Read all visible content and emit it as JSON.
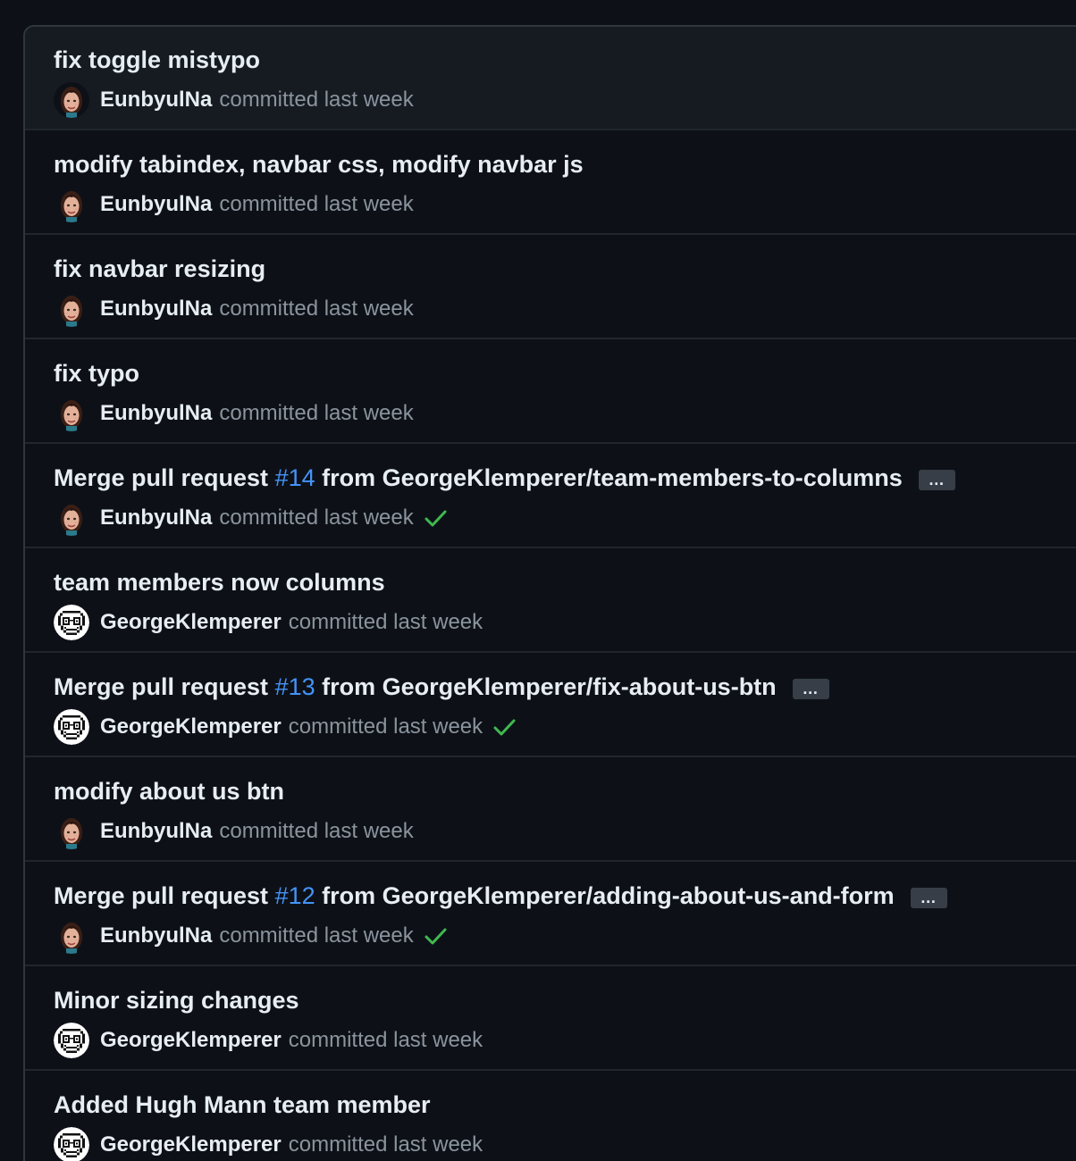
{
  "commits": [
    {
      "title": "fix toggle mistypo",
      "title_suffix": "",
      "pr": "",
      "author": "EunbyulNa",
      "when": "committed last week",
      "has_more": false,
      "has_check": false,
      "avatar": "memoji-avatar"
    },
    {
      "title": "modify tabindex, navbar css, modify navbar js",
      "title_suffix": "",
      "pr": "",
      "author": "EunbyulNa",
      "when": "committed last week",
      "has_more": false,
      "has_check": false,
      "avatar": "memoji-avatar"
    },
    {
      "title": "fix navbar resizing",
      "title_suffix": "",
      "pr": "",
      "author": "EunbyulNa",
      "when": "committed last week",
      "has_more": false,
      "has_check": false,
      "avatar": "memoji-avatar"
    },
    {
      "title": "fix typo",
      "title_suffix": "",
      "pr": "",
      "author": "EunbyulNa",
      "when": "committed last week",
      "has_more": false,
      "has_check": false,
      "avatar": "memoji-avatar"
    },
    {
      "title": "Merge pull request ",
      "pr": "#14",
      "title_suffix": " from GeorgeKlemperer/team-members-to-columns",
      "author": "EunbyulNa",
      "when": "committed last week",
      "has_more": true,
      "more_label": "…",
      "has_check": true,
      "avatar": "memoji-avatar"
    },
    {
      "title": "team members now columns",
      "title_suffix": "",
      "pr": "",
      "author": "GeorgeKlemperer",
      "when": "committed last week",
      "has_more": false,
      "has_check": false,
      "avatar": "pixel-face-avatar"
    },
    {
      "title": "Merge pull request ",
      "pr": "#13",
      "title_suffix": " from GeorgeKlemperer/fix-about-us-btn",
      "author": "GeorgeKlemperer",
      "when": "committed last week",
      "has_more": true,
      "more_label": "…",
      "has_check": true,
      "avatar": "pixel-face-avatar"
    },
    {
      "title": "modify about us btn",
      "title_suffix": "",
      "pr": "",
      "author": "EunbyulNa",
      "when": "committed last week",
      "has_more": false,
      "has_check": false,
      "avatar": "memoji-avatar"
    },
    {
      "title": "Merge pull request ",
      "pr": "#12",
      "title_suffix": " from GeorgeKlemperer/adding-about-us-and-form",
      "author": "EunbyulNa",
      "when": "committed last week",
      "has_more": true,
      "more_label": "…",
      "has_check": true,
      "avatar": "memoji-avatar"
    },
    {
      "title": "Minor sizing changes",
      "title_suffix": "",
      "pr": "",
      "author": "GeorgeKlemperer",
      "when": "committed last week",
      "has_more": false,
      "has_check": false,
      "avatar": "pixel-face-avatar"
    },
    {
      "title": "Added Hugh Mann team member",
      "title_suffix": "",
      "pr": "",
      "author": "GeorgeKlemperer",
      "when": "committed last week",
      "has_more": false,
      "has_check": false,
      "avatar": "pixel-face-avatar"
    }
  ],
  "colors": {
    "background": "#0d1117",
    "first_row_background": "#161b22",
    "text_primary": "#e6edf3",
    "text_muted": "#8b949e",
    "link": "#4493f8",
    "success": "#3fb950",
    "border": "#30363d"
  }
}
